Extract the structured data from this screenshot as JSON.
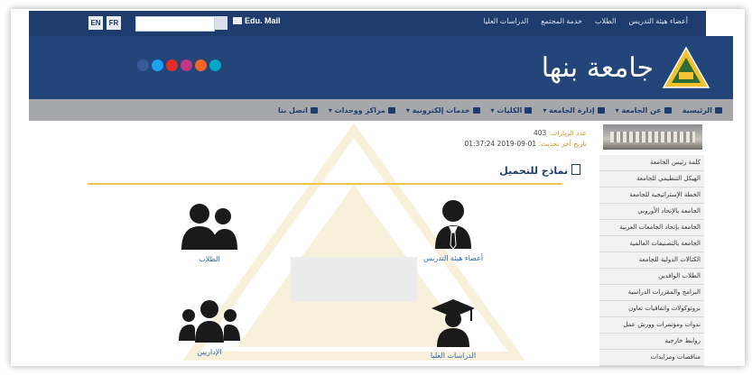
{
  "topbar": {
    "lang_en": "EN",
    "lang_fr": "FR",
    "email_label": "Edu. Mail",
    "links": [
      "أعضاء هيئة التدريس",
      "الطلاب",
      "خدمة المجتمع",
      "الدراسات العليا"
    ]
  },
  "header": {
    "university_name": "جامعة بنها",
    "social": [
      {
        "name": "facebook-icon",
        "color": "#3b5998"
      },
      {
        "name": "twitter-icon",
        "color": "#1da1f2"
      },
      {
        "name": "youtube-icon",
        "color": "#e52d27"
      },
      {
        "name": "instagram-icon",
        "color": "#c13584"
      },
      {
        "name": "rss-icon",
        "color": "#f26522"
      },
      {
        "name": "flickr-icon",
        "color": "#00a8c6"
      }
    ]
  },
  "nav": {
    "items": [
      "الرئيسية",
      "عن الجامعة ▾",
      "إدارة الجامعة ▾",
      "الكليات ▾",
      "خدمات إلكترونية ▾",
      "مراكز ووحدات ▾",
      "اتصل بنا"
    ]
  },
  "stats": {
    "visits_label": "عدد الزيارات:",
    "visits_value": "403",
    "updated_label": "تاريخ آخر تحديث:",
    "updated_value": "01-09-2019 01:37:24"
  },
  "main": {
    "section_title": "نماذج للتحميل",
    "cards": {
      "faculty": "أعضاء هيئة التدريس",
      "students": "الطلاب",
      "postgrad": "الدراسات العليا",
      "admin": "الإداريين"
    }
  },
  "sidebar": {
    "items": [
      "كلمة رئيس الجامعة",
      "الهيكل التنظيمي للجامعة",
      "الخطة الإستراتيجية للجامعة",
      "الجامعة بالإتحاد الأوروبي",
      "الجامعة بإتحاد الجامعات العربية",
      "الجامعة بالتصنيفات العالمية",
      "الكتالات الدولية للجامعة",
      "الطلاب الوافدين",
      "البرامج والمقررات الدراسية",
      "بروتوكولات واتفاقيات تعاون",
      "ندوات ومؤتمرات وورش عمل",
      "روابط خارجية",
      "مناقصات ومزايدات"
    ]
  },
  "colors": {
    "header_blue": "#23457a",
    "topbar_blue": "#1e3d6e",
    "nav_gray": "#a5a7aa",
    "accent_gold": "#f0c34a",
    "link_blue": "#2a6ab0"
  }
}
